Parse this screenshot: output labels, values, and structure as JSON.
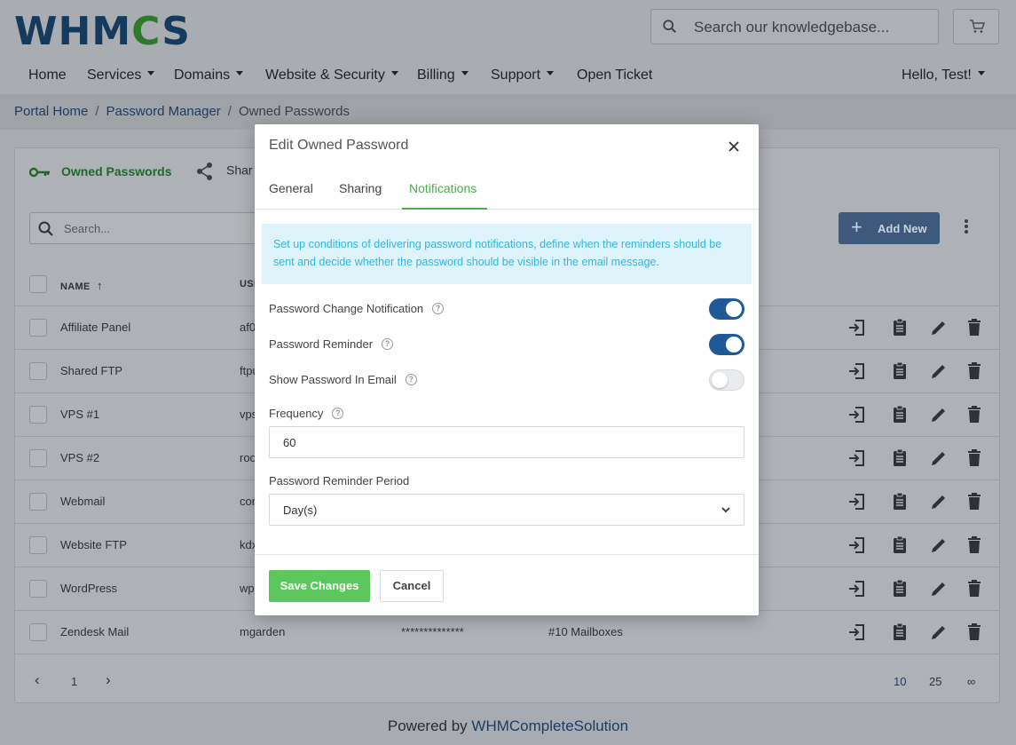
{
  "logo": {
    "text_a": "WHM",
    "text_b": "C",
    "text_c": "S"
  },
  "search": {
    "placeholder": "Search our knowledgebase..."
  },
  "nav": {
    "items": [
      {
        "label": "Home",
        "dropdown": false
      },
      {
        "label": "Services",
        "dropdown": true
      },
      {
        "label": "Domains",
        "dropdown": true
      },
      {
        "label": "Website & Security",
        "dropdown": true
      },
      {
        "label": "Billing",
        "dropdown": true
      },
      {
        "label": "Support",
        "dropdown": true
      },
      {
        "label": "Open Ticket",
        "dropdown": false
      }
    ],
    "user": "Hello, Test!"
  },
  "breadcrumb": {
    "home": "Portal Home",
    "manager": "Password Manager",
    "current": "Owned Passwords",
    "sep": "/"
  },
  "card": {
    "tab_owned": "Owned Passwords",
    "tab_shared": "Shar",
    "search_placeholder": "Search...",
    "add_new": "Add New",
    "columns": {
      "name": "NAME",
      "username": "USE"
    },
    "rows": [
      {
        "name": "Affiliate Panel",
        "user": "af0"
      },
      {
        "name": "Shared FTP",
        "user": "ftpu"
      },
      {
        "name": "VPS #1",
        "user": "vps"
      },
      {
        "name": "VPS #2",
        "user": "roo"
      },
      {
        "name": "Webmail",
        "user": "cor"
      },
      {
        "name": "Website FTP",
        "user": "kdx"
      },
      {
        "name": "WordPress",
        "user": "wp"
      },
      {
        "name": "Zendesk Mail",
        "user": "mgarden",
        "password": "**************",
        "related": "#10 Mailboxes"
      }
    ],
    "pager": {
      "current": "1",
      "sizes": [
        "10",
        "25",
        "∞"
      ]
    }
  },
  "footer": {
    "prefix": "Powered by",
    "link": "WHMCompleteSolution"
  },
  "modal": {
    "title": "Edit Owned Password",
    "tabs": [
      "General",
      "Sharing",
      "Notifications"
    ],
    "active_tab": "Notifications",
    "info": "Set up conditions of delivering password notifications, define when the reminders should be sent and decide whether the password should be visible in the email message.",
    "fields": {
      "change_notification": {
        "label": "Password Change Notification",
        "enabled": true
      },
      "reminder": {
        "label": "Password Reminder",
        "enabled": true
      },
      "show_in_email": {
        "label": "Show Password In Email",
        "enabled": false
      },
      "frequency": {
        "label": "Frequency",
        "value": "60"
      },
      "period": {
        "label": "Password Reminder Period",
        "value": "Day(s)"
      }
    },
    "save": "Save Changes",
    "cancel": "Cancel"
  },
  "colors": {
    "accent_green": "#4cae4c",
    "toggle_on": "#1f5a96",
    "info_bg": "#dff3fb",
    "info_text": "#35b5e0"
  }
}
